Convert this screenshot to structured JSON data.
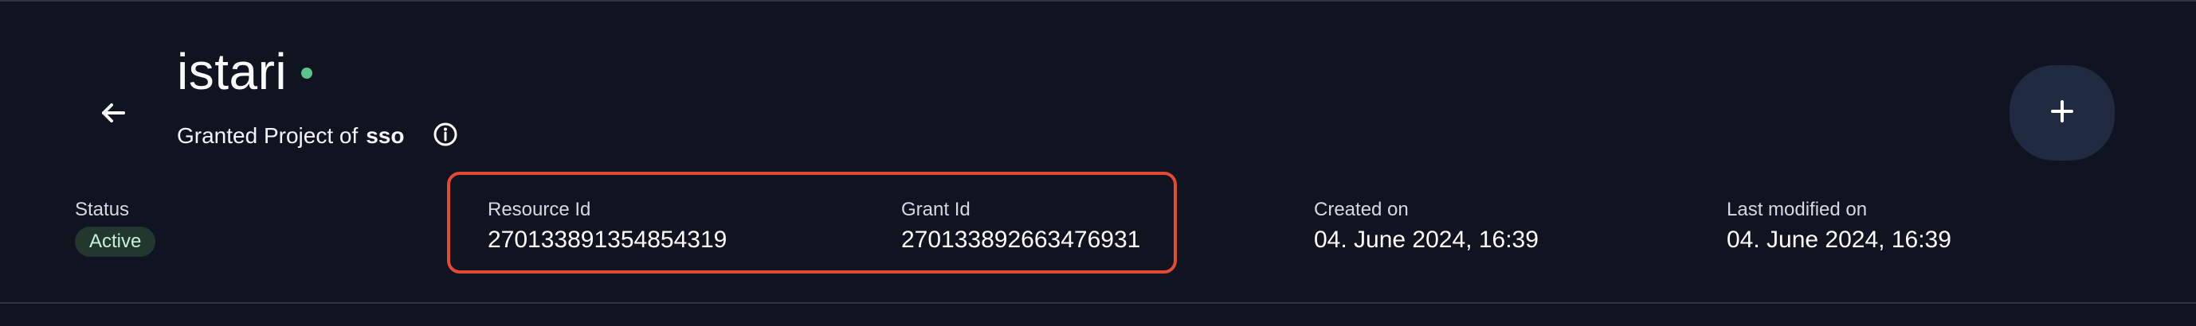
{
  "header": {
    "title": "istari",
    "subtitle_prefix": "Granted Project of",
    "subtitle_owner": "sso",
    "back_icon": "arrow-left-icon",
    "info_icon": "info-circle-icon",
    "add_icon": "plus-icon",
    "status_dot_color": "#5cc58f"
  },
  "details": {
    "status_label": "Status",
    "status_value": "Active",
    "resource_label": "Resource Id",
    "resource_value": "270133891354854319",
    "grant_label": "Grant Id",
    "grant_value": "270133892663476931",
    "created_label": "Created on",
    "created_value": "04. June 2024, 16:39",
    "modified_label": "Last modified on",
    "modified_value": "04. June 2024, 16:39"
  },
  "colors": {
    "background": "#0f1420",
    "highlight_border": "#e24a33",
    "button_bg": "#202b42",
    "status_badge_bg": "#24372f",
    "status_badge_text": "#c6f1d8"
  }
}
